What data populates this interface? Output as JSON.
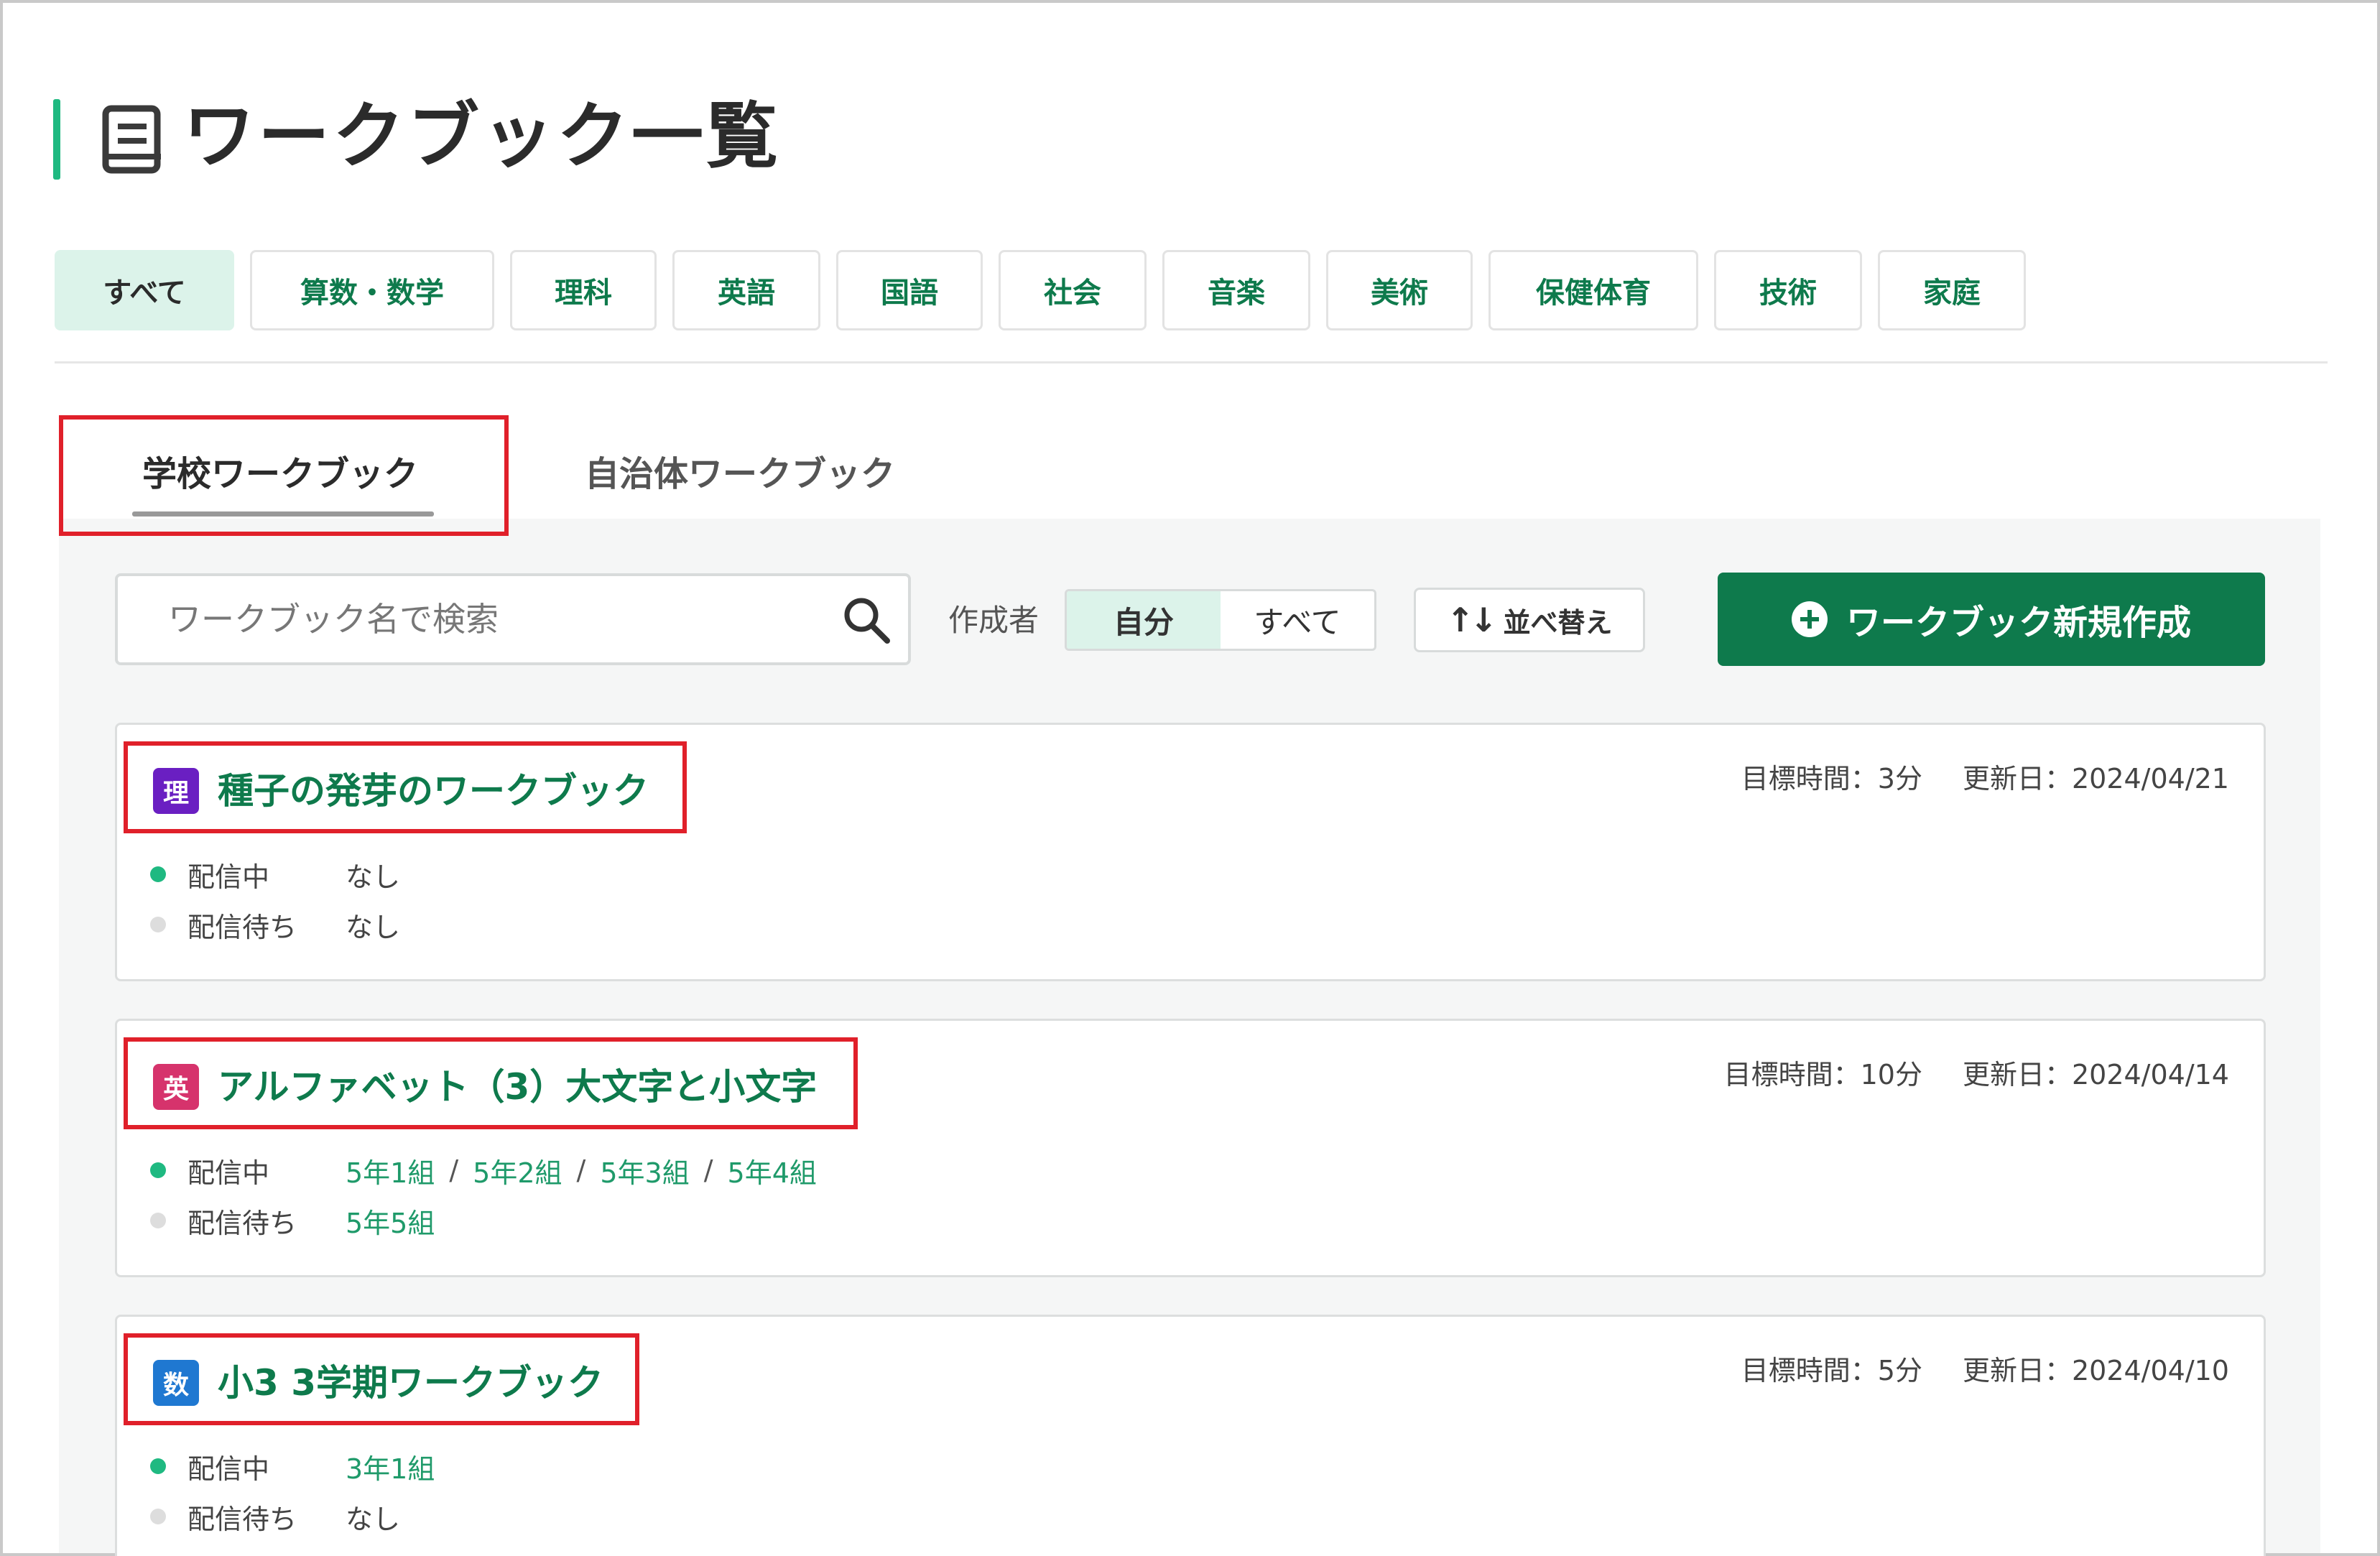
{
  "page": {
    "title": "ワークブック一覧",
    "title_icon": "workbook-icon"
  },
  "subjects": [
    {
      "label": "すべて",
      "active": true
    },
    {
      "label": "算数・数学",
      "active": false
    },
    {
      "label": "理科",
      "active": false
    },
    {
      "label": "英語",
      "active": false
    },
    {
      "label": "国語",
      "active": false
    },
    {
      "label": "社会",
      "active": false
    },
    {
      "label": "音楽",
      "active": false
    },
    {
      "label": "美術",
      "active": false
    },
    {
      "label": "保健体育",
      "active": false
    },
    {
      "label": "技術",
      "active": false
    },
    {
      "label": "家庭",
      "active": false
    }
  ],
  "tabs": [
    {
      "label": "学校ワークブック",
      "active": true
    },
    {
      "label": "自治体ワークブック",
      "active": false
    }
  ],
  "toolbar": {
    "search_placeholder": "ワークブック名で検索",
    "creator_label": "作成者",
    "creator_options": [
      "自分",
      "すべて"
    ],
    "creator_selected": "自分",
    "sort_label": "並べ替え",
    "create_label": "ワークブック新規作成"
  },
  "workbooks": [
    {
      "badge": "理",
      "badge_color": "#6a1fc2",
      "title": "種子の発芽のワークブック",
      "target_time": "目標時間：3分",
      "updated": "更新日：2024/04/21",
      "delivering_label": "配信中",
      "waiting_label": "配信待ち",
      "delivering": [],
      "delivering_none": "なし",
      "waiting": [],
      "waiting_none": "なし"
    },
    {
      "badge": "英",
      "badge_color": "#d6336c",
      "title": "アルファベット（3）大文字と小文字",
      "target_time": "目標時間：10分",
      "updated": "更新日：2024/04/14",
      "delivering_label": "配信中",
      "waiting_label": "配信待ち",
      "delivering": [
        "5年1組",
        "5年2組",
        "5年3組",
        "5年4組"
      ],
      "delivering_none": "",
      "waiting": [
        "5年5組"
      ],
      "waiting_none": ""
    },
    {
      "badge": "数",
      "badge_color": "#1f78d1",
      "title": "小3 3学期ワークブック",
      "target_time": "目標時間：5分",
      "updated": "更新日：2024/04/10",
      "delivering_label": "配信中",
      "waiting_label": "配信待ち",
      "delivering": [
        "3年1組"
      ],
      "delivering_none": "",
      "waiting": [],
      "waiting_none": "なし"
    }
  ],
  "colors": {
    "accent": "#0e7a4c",
    "accent_light": "#dcf3ea",
    "annotation": "#e0202a",
    "status_green": "#1fb981"
  }
}
